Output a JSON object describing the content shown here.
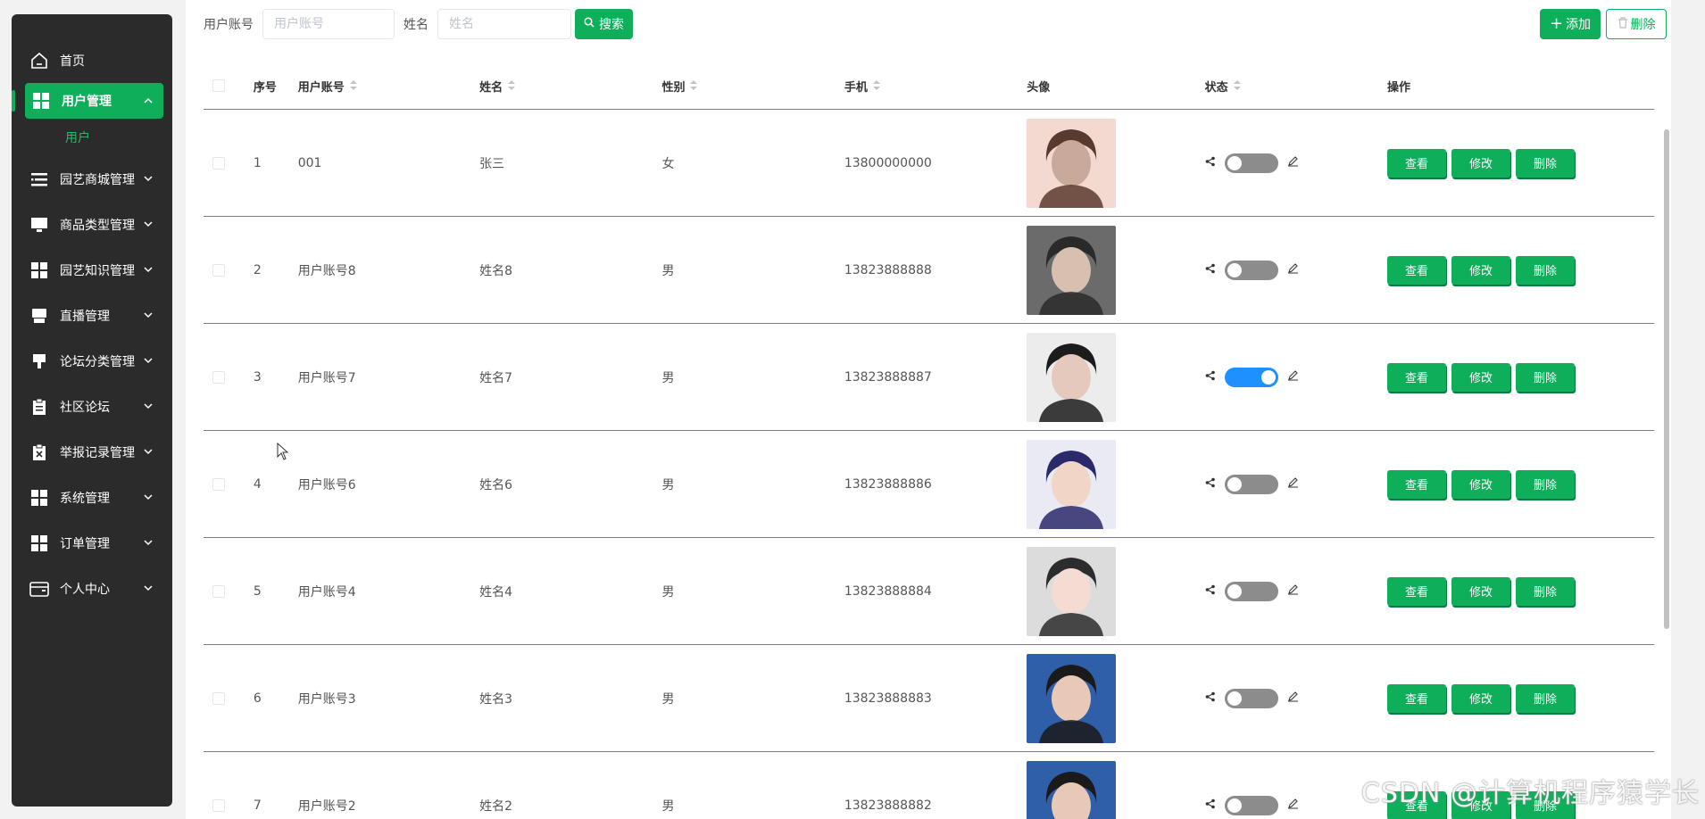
{
  "sidebar": {
    "items": [
      {
        "label": "首页",
        "icon": "home-icon"
      },
      {
        "label": "用户管理",
        "icon": "grid-icon",
        "active": true,
        "sub": [
          "用户"
        ]
      },
      {
        "label": "园艺商城管理",
        "icon": "list-icon"
      },
      {
        "label": "商品类型管理",
        "icon": "monitor-icon"
      },
      {
        "label": "园艺知识管理",
        "icon": "grid-icon"
      },
      {
        "label": "直播管理",
        "icon": "printer-icon"
      },
      {
        "label": "论坛分类管理",
        "icon": "stamp-icon"
      },
      {
        "label": "社区论坛",
        "icon": "clipboard-icon"
      },
      {
        "label": "举报记录管理",
        "icon": "clipboard-x-icon"
      },
      {
        "label": "系统管理",
        "icon": "grid-icon"
      },
      {
        "label": "订单管理",
        "icon": "grid-icon"
      },
      {
        "label": "个人中心",
        "icon": "wallet-icon"
      }
    ]
  },
  "toolbar": {
    "account_label": "用户账号",
    "account_placeholder": "用户账号",
    "name_label": "姓名",
    "name_placeholder": "姓名",
    "search_label": "搜索",
    "add_label": "添加",
    "delete_label": "删除"
  },
  "table": {
    "headers": {
      "index": "序号",
      "account": "用户账号",
      "name": "姓名",
      "sex": "性别",
      "phone": "手机",
      "avatar": "头像",
      "status": "状态",
      "ops": "操作"
    },
    "rows": [
      {
        "index": "1",
        "account": "001",
        "name": "张三",
        "sex": "女",
        "phone": "13800000000",
        "status_on": false
      },
      {
        "index": "2",
        "account": "用户账号8",
        "name": "姓名8",
        "sex": "男",
        "phone": "13823888888",
        "status_on": false
      },
      {
        "index": "3",
        "account": "用户账号7",
        "name": "姓名7",
        "sex": "男",
        "phone": "13823888887",
        "status_on": true
      },
      {
        "index": "4",
        "account": "用户账号6",
        "name": "姓名6",
        "sex": "男",
        "phone": "13823888886",
        "status_on": false
      },
      {
        "index": "5",
        "account": "用户账号4",
        "name": "姓名4",
        "sex": "男",
        "phone": "13823888884",
        "status_on": false
      },
      {
        "index": "6",
        "account": "用户账号3",
        "name": "姓名3",
        "sex": "男",
        "phone": "13823888883",
        "status_on": false
      },
      {
        "index": "7",
        "account": "用户账号2",
        "name": "姓名2",
        "sex": "男",
        "phone": "13823888882",
        "status_on": false
      }
    ],
    "ops": {
      "view": "查看",
      "edit": "修改",
      "delete": "删除"
    }
  },
  "watermark": "CSDN @计算机程序猿学长",
  "colors": {
    "accent": "#0fae5a",
    "sidebar_bg": "#2b2b2b",
    "toggle_on": "#1e90ff",
    "toggle_off": "#8c8c8c"
  }
}
